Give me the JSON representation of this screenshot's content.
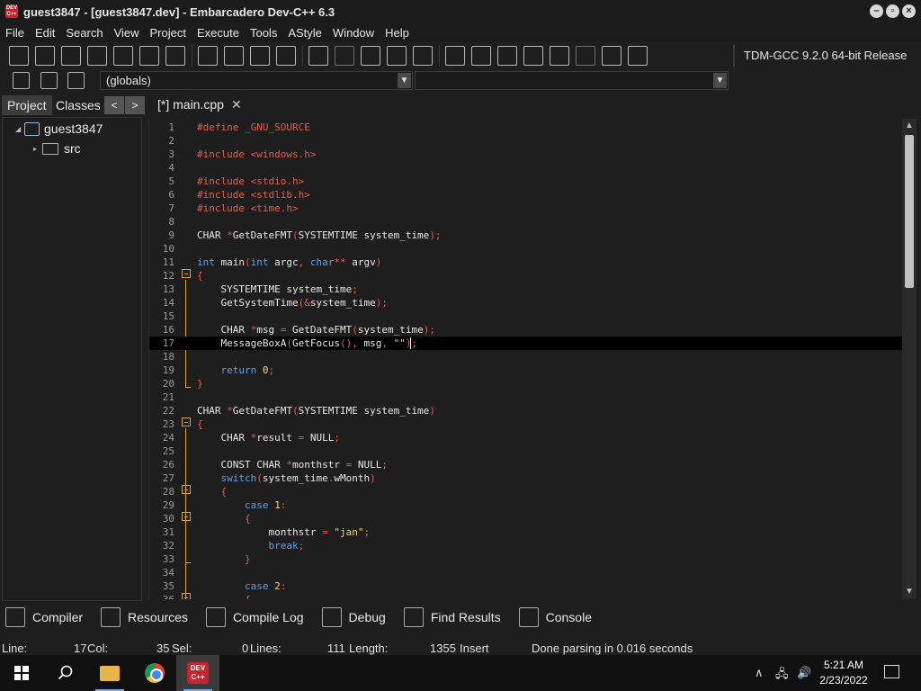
{
  "window": {
    "title": "guest3847 - [guest3847.dev] - Embarcadero Dev-C++ 6.3",
    "app_icon_text": "DEV C++"
  },
  "menu": [
    "File",
    "Edit",
    "Search",
    "View",
    "Project",
    "Execute",
    "Tools",
    "AStyle",
    "Window",
    "Help"
  ],
  "toolbar": {
    "compiler": "TDM-GCC 9.2.0 64-bit Release"
  },
  "toolbar2": {
    "scope_combo": "(globals)",
    "member_combo": ""
  },
  "left_panel": {
    "tabs": [
      "Project",
      "Classes"
    ],
    "active_tab": "Project",
    "tree": {
      "root": "guest3847",
      "children": [
        "src"
      ]
    }
  },
  "editor": {
    "tab_label": "[*] main.cpp",
    "current_line": 17,
    "lines": [
      {
        "n": "1",
        "html": "<span class=\"pp\">#define _GNU_SOURCE</span>"
      },
      {
        "n": "2",
        "html": ""
      },
      {
        "n": "3",
        "html": "<span class=\"pp\">#include &lt;windows.h&gt;</span>"
      },
      {
        "n": "4",
        "html": ""
      },
      {
        "n": "5",
        "html": "<span class=\"pp\">#include &lt;stdio.h&gt;</span>"
      },
      {
        "n": "6",
        "html": "<span class=\"pp\">#include &lt;stdlib.h&gt;</span>"
      },
      {
        "n": "7",
        "html": "<span class=\"pp\">#include &lt;time.h&gt;</span>"
      },
      {
        "n": "8",
        "html": ""
      },
      {
        "n": "9",
        "html": "CHAR <span class=\"sym\">*</span>GetDateFMT<span class=\"sym\">(</span>SYSTEMTIME system_time<span class=\"sym\">);</span>"
      },
      {
        "n": "10",
        "html": ""
      },
      {
        "n": "11",
        "html": "<span class=\"kw\">int</span> main<span class=\"sym\">(</span><span class=\"kw\">int</span> argc<span class=\"sym\">,</span> <span class=\"kw\">char</span><span class=\"sym\">**</span> argv<span class=\"sym\">)</span>"
      },
      {
        "n": "12",
        "html": "<span class=\"sym\">{</span>"
      },
      {
        "n": "13",
        "html": "    SYSTEMTIME system_time<span class=\"sym\">;</span>"
      },
      {
        "n": "14",
        "html": "    GetSystemTime<span class=\"sym\">(&amp;</span>system_time<span class=\"sym\">);</span>"
      },
      {
        "n": "15",
        "html": ""
      },
      {
        "n": "16",
        "html": "    CHAR <span class=\"sym\">*</span>msg <span class=\"sym\">=</span> GetDateFMT<span class=\"sym\">(</span>system_time<span class=\"sym\">);</span>"
      },
      {
        "n": "17",
        "html": "    MessageBoxA<span class=\"sym\">(</span>GetFocus<span class=\"sym\">(),</span> msg<span class=\"sym\">,</span> <span class=\"str\">\"\"</span><span class=\"sym\">);</span>"
      },
      {
        "n": "18",
        "html": ""
      },
      {
        "n": "19",
        "html": "    <span class=\"kw\">return</span> <span class=\"num\">0</span><span class=\"sym\">;</span>"
      },
      {
        "n": "20",
        "html": "<span class=\"sym\">}</span>"
      },
      {
        "n": "21",
        "html": ""
      },
      {
        "n": "22",
        "html": "CHAR <span class=\"sym\">*</span>GetDateFMT<span class=\"sym\">(</span>SYSTEMTIME system_time<span class=\"sym\">)</span>"
      },
      {
        "n": "23",
        "html": "<span class=\"sym\">{</span>"
      },
      {
        "n": "24",
        "html": "    CHAR <span class=\"sym\">*</span>result <span class=\"sym\">=</span> NULL<span class=\"sym\">;</span>"
      },
      {
        "n": "25",
        "html": ""
      },
      {
        "n": "26",
        "html": "    CONST CHAR <span class=\"sym\">*</span>monthstr <span class=\"sym\">=</span> NULL<span class=\"sym\">;</span>"
      },
      {
        "n": "27",
        "html": "    <span class=\"kw\">switch</span><span class=\"sym\">(</span>system_time<span class=\"sym\">.</span>wMonth<span class=\"sym\">)</span>"
      },
      {
        "n": "28",
        "html": "    <span class=\"sym\">{</span>"
      },
      {
        "n": "29",
        "html": "        <span class=\"kw\">case</span> <span class=\"num\">1</span><span class=\"sym\">:</span>"
      },
      {
        "n": "30",
        "html": "        <span class=\"sym\">{</span>"
      },
      {
        "n": "31",
        "html": "            monthstr <span class=\"sym\">=</span> <span class=\"str\">\"jan\"</span><span class=\"sym\">;</span>"
      },
      {
        "n": "32",
        "html": "            <span class=\"kw\">break</span><span class=\"sym\">;</span>"
      },
      {
        "n": "33",
        "html": "        <span class=\"sym\">}</span>"
      },
      {
        "n": "34",
        "html": ""
      },
      {
        "n": "35",
        "html": "        <span class=\"kw\">case</span> <span class=\"num\">2</span><span class=\"sym\">:</span>"
      },
      {
        "n": "36",
        "html": "        <span class=\"sym\">{</span>"
      }
    ]
  },
  "bottom_tabs": [
    "Compiler",
    "Resources",
    "Compile Log",
    "Debug",
    "Find Results",
    "Console"
  ],
  "status": {
    "line_label": "Line:",
    "line_value": "17",
    "col_label": "Col:",
    "col_value": "35",
    "sel_label": "Sel:",
    "sel_value": "0",
    "lines_label": "Lines:",
    "lines_value": "111",
    "length_label": "Length:",
    "length_value": "1355",
    "mode": "Insert",
    "message": "Done parsing in 0.016 seconds"
  },
  "taskbar": {
    "time": "5:21 AM",
    "date": "2/23/2022",
    "devcpp_label": "DEV C++"
  }
}
